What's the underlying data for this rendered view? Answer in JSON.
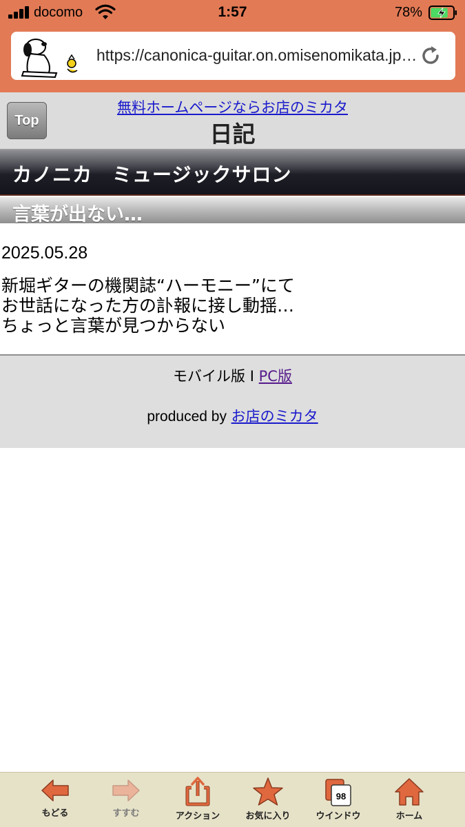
{
  "status_bar": {
    "carrier": "docomo",
    "time": "1:57",
    "battery_percent": "78%",
    "battery_level": 0.78
  },
  "browser": {
    "url": "https://canonica-guitar.on.omisenomikata.jp/diary/"
  },
  "header": {
    "top_button": "Top",
    "ad_link": "無料ホームページならお店のミカタ",
    "page_title": "日記"
  },
  "shop": {
    "name": "カノニカ　ミュージックサロン"
  },
  "entry": {
    "title": "言葉が出ない…",
    "date": "2025.05.28",
    "lines": [
      "新堀ギターの機関誌“ハーモニー”にて",
      "お世話になった方の訃報に接し動揺…",
      "ちょっと言葉が見つからない"
    ]
  },
  "footer": {
    "mobile_version": "モバイル版",
    "separator": "I",
    "pc_version": "PC版",
    "produced_by": "produced by",
    "maker": "お店のミカタ"
  },
  "toolbar": {
    "items": [
      {
        "label": "もどる",
        "icon": "back-arrow-icon"
      },
      {
        "label": "すすむ",
        "icon": "forward-arrow-icon"
      },
      {
        "label": "アクション",
        "icon": "share-icon"
      },
      {
        "label": "お気に入り",
        "icon": "star-icon"
      },
      {
        "label": "ウインドウ",
        "icon": "windows-icon",
        "badge": "98"
      },
      {
        "label": "ホーム",
        "icon": "home-icon"
      }
    ]
  },
  "colors": {
    "chrome": "#e27a55",
    "toolbar_bg": "#e6e2c8",
    "icon_orange": "#e0683f"
  }
}
